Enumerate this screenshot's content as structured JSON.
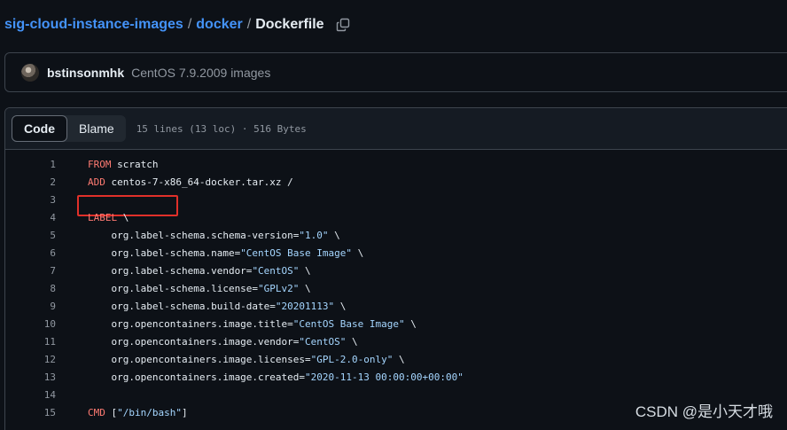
{
  "breadcrumb": {
    "repo": "sig-cloud-instance-images",
    "separator": "/",
    "folder": "docker",
    "file": "Dockerfile",
    "copy_icon": "copy-icon"
  },
  "commit": {
    "author": "bstinsonmhk",
    "message": "CentOS 7.9.2009 images"
  },
  "file_header": {
    "code_tab": "Code",
    "blame_tab": "Blame",
    "meta": "15 lines (13 loc) · 516 Bytes"
  },
  "code_lines": [
    {
      "num": "1",
      "parts": [
        {
          "t": "FROM",
          "c": "kw"
        },
        {
          "t": " scratch",
          "c": ""
        }
      ]
    },
    {
      "num": "2",
      "parts": [
        {
          "t": "ADD",
          "c": "kw"
        },
        {
          "t": " centos-7-x86_64-docker.tar.xz /",
          "c": ""
        }
      ]
    },
    {
      "num": "3",
      "parts": []
    },
    {
      "num": "4",
      "parts": [
        {
          "t": "LABEL",
          "c": "kw"
        },
        {
          "t": " \\",
          "c": ""
        }
      ]
    },
    {
      "num": "5",
      "parts": [
        {
          "t": "    org.label-schema.schema-version=",
          "c": ""
        },
        {
          "t": "\"1.0\"",
          "c": "str"
        },
        {
          "t": " \\",
          "c": ""
        }
      ]
    },
    {
      "num": "6",
      "parts": [
        {
          "t": "    org.label-schema.name=",
          "c": ""
        },
        {
          "t": "\"CentOS Base Image\"",
          "c": "str"
        },
        {
          "t": " \\",
          "c": ""
        }
      ]
    },
    {
      "num": "7",
      "parts": [
        {
          "t": "    org.label-schema.vendor=",
          "c": ""
        },
        {
          "t": "\"CentOS\"",
          "c": "str"
        },
        {
          "t": " \\",
          "c": ""
        }
      ]
    },
    {
      "num": "8",
      "parts": [
        {
          "t": "    org.label-schema.license=",
          "c": ""
        },
        {
          "t": "\"GPLv2\"",
          "c": "str"
        },
        {
          "t": " \\",
          "c": ""
        }
      ]
    },
    {
      "num": "9",
      "parts": [
        {
          "t": "    org.label-schema.build-date=",
          "c": ""
        },
        {
          "t": "\"20201113\"",
          "c": "str"
        },
        {
          "t": " \\",
          "c": ""
        }
      ]
    },
    {
      "num": "10",
      "parts": [
        {
          "t": "    org.opencontainers.image.title=",
          "c": ""
        },
        {
          "t": "\"CentOS Base Image\"",
          "c": "str"
        },
        {
          "t": " \\",
          "c": ""
        }
      ]
    },
    {
      "num": "11",
      "parts": [
        {
          "t": "    org.opencontainers.image.vendor=",
          "c": ""
        },
        {
          "t": "\"CentOS\"",
          "c": "str"
        },
        {
          "t": " \\",
          "c": ""
        }
      ]
    },
    {
      "num": "12",
      "parts": [
        {
          "t": "    org.opencontainers.image.licenses=",
          "c": ""
        },
        {
          "t": "\"GPL-2.0-only\"",
          "c": "str"
        },
        {
          "t": " \\",
          "c": ""
        }
      ]
    },
    {
      "num": "13",
      "parts": [
        {
          "t": "    org.opencontainers.image.created=",
          "c": ""
        },
        {
          "t": "\"2020-11-13 00:00:00+00:00\"",
          "c": "str"
        }
      ]
    },
    {
      "num": "14",
      "parts": []
    },
    {
      "num": "15",
      "parts": [
        {
          "t": "CMD",
          "c": "kw"
        },
        {
          "t": " [",
          "c": ""
        },
        {
          "t": "\"/bin/bash\"",
          "c": "str"
        },
        {
          "t": "]",
          "c": ""
        }
      ]
    }
  ],
  "watermark": "CSDN @是小天才哦",
  "colors": {
    "background": "#0d1117",
    "link": "#4493f8",
    "keyword": "#ff7b72",
    "string": "#a5d6ff",
    "highlight_box": "#e0302a"
  }
}
